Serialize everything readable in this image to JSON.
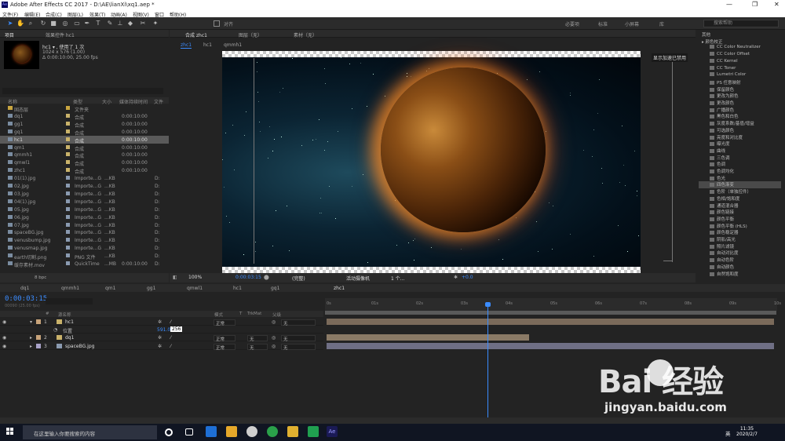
{
  "window": {
    "title": "Adobe After Effects CC 2017 - D:\\AE\\lianXi\\xq1.aep *",
    "logo": "Ae",
    "min": "—",
    "max": "❐",
    "close": "✕"
  },
  "menu": [
    "文件(F)",
    "编辑(E)",
    "合成(C)",
    "图层(L)",
    "效果(T)",
    "动画(A)",
    "视图(V)",
    "窗口",
    "帮助(H)"
  ],
  "toolbar": {
    "snap_label": "对齐",
    "workspaces": [
      "必要项",
      "标准",
      "小屏幕",
      "库"
    ],
    "search_placeholder": "搜索帮助"
  },
  "project": {
    "tabs": [
      "项目",
      "效果控件 hc1"
    ],
    "selected_name": "hc1 ▾ , 使用了 1 次",
    "selected_size": "1024 x 576 (1.00)",
    "selected_dur": "Δ 0:00:10:00, 25.00 fps",
    "columns": [
      "名称",
      "类型",
      "大小",
      "媒体持续时间",
      "文件"
    ],
    "rows": [
      {
        "name": "固态层",
        "type": "文件夹",
        "size": "",
        "dur": "",
        "fp": "",
        "kind": "folder",
        "swatch": "#c9a640"
      },
      {
        "name": "dq1",
        "type": "合成",
        "size": "",
        "dur": "0:00:10:00",
        "fp": "",
        "kind": "comp",
        "swatch": "#c9b26a"
      },
      {
        "name": "gg1",
        "type": "合成",
        "size": "",
        "dur": "0:00:10:00",
        "fp": "",
        "kind": "comp",
        "swatch": "#c9b26a"
      },
      {
        "name": "gq1",
        "type": "合成",
        "size": "",
        "dur": "0:00:10:00",
        "fp": "",
        "kind": "comp",
        "swatch": "#c9b26a"
      },
      {
        "name": "hc1",
        "type": "合成",
        "size": "",
        "dur": "0:00:10:00",
        "fp": "",
        "kind": "comp",
        "swatch": "#c9b26a",
        "selected": true
      },
      {
        "name": "qm1",
        "type": "合成",
        "size": "",
        "dur": "0:00:10:00",
        "fp": "",
        "kind": "comp",
        "swatch": "#c9b26a"
      },
      {
        "name": "qmmh1",
        "type": "合成",
        "size": "",
        "dur": "0:00:10:00",
        "fp": "",
        "kind": "comp",
        "swatch": "#c9b26a"
      },
      {
        "name": "qmwl1",
        "type": "合成",
        "size": "",
        "dur": "0:00:10:00",
        "fp": "",
        "kind": "comp",
        "swatch": "#c9b26a"
      },
      {
        "name": "zhc1",
        "type": "合成",
        "size": "",
        "dur": "0:00:10:00",
        "fp": "",
        "kind": "comp",
        "swatch": "#c9b26a"
      },
      {
        "name": "01(1).jpg",
        "type": "Importe...G",
        "size": "...KB",
        "dur": "",
        "fp": "D:",
        "kind": "file",
        "swatch": "#8a9ab0"
      },
      {
        "name": "02.jpg",
        "type": "Importe...G",
        "size": "...KB",
        "dur": "",
        "fp": "D:",
        "kind": "file",
        "swatch": "#8a9ab0"
      },
      {
        "name": "03.jpg",
        "type": "Importe...G",
        "size": "...KB",
        "dur": "",
        "fp": "D:",
        "kind": "file",
        "swatch": "#8a9ab0"
      },
      {
        "name": "04(1).jpg",
        "type": "Importe...G",
        "size": "...KB",
        "dur": "",
        "fp": "D:",
        "kind": "file",
        "swatch": "#8a9ab0"
      },
      {
        "name": "05.jpg",
        "type": "Importe...G",
        "size": "...KB",
        "dur": "",
        "fp": "D:",
        "kind": "file",
        "swatch": "#8a9ab0"
      },
      {
        "name": "06.jpg",
        "type": "Importe...G",
        "size": "...KB",
        "dur": "",
        "fp": "D:",
        "kind": "file",
        "swatch": "#8a9ab0"
      },
      {
        "name": "07.jpg",
        "type": "Importe...G",
        "size": "...KB",
        "dur": "",
        "fp": "D:",
        "kind": "file",
        "swatch": "#8a9ab0"
      },
      {
        "name": "spaceBG.jpg",
        "type": "Importe...G",
        "size": "...KB",
        "dur": "",
        "fp": "D:",
        "kind": "file",
        "swatch": "#8a9ab0"
      },
      {
        "name": "venusbump.jpg",
        "type": "Importe...G",
        "size": "...KB",
        "dur": "",
        "fp": "D:",
        "kind": "file",
        "swatch": "#8a9ab0"
      },
      {
        "name": "venusmap.jpg",
        "type": "Importe...G",
        "size": "...KB",
        "dur": "",
        "fp": "D:",
        "kind": "file",
        "swatch": "#8a9ab0"
      },
      {
        "name": "earth切割.png",
        "type": "PNG 文件",
        "size": "...KB",
        "dur": "",
        "fp": "D:",
        "kind": "file",
        "swatch": "#8a9ab0"
      },
      {
        "name": "缓存素材.mov",
        "type": "QuickTime",
        "size": "...MB",
        "dur": "0:00:10:00",
        "fp": "D:",
        "kind": "file",
        "swatch": "#8a9ab0"
      }
    ],
    "footer_bpc": "8 bpc"
  },
  "viewer": {
    "tabs": [
      "合成 zhc1",
      "图层（无）",
      "素材（无）"
    ],
    "breadcrumbs": [
      "zhc1",
      "hc1",
      "qmmh1"
    ],
    "badge": "显示加速已禁用",
    "zoom": "100%",
    "timecode": "0:00:03:15",
    "resolution": "(完整)",
    "camera": "活动摄像机",
    "views": "1 个...",
    "exposure": "+0.0"
  },
  "effects": {
    "items": [
      {
        "label": "其他",
        "indent": 0
      },
      {
        "label": "▸ 颜色校正",
        "indent": 0
      },
      {
        "label": "CC Color Neutralizer"
      },
      {
        "label": "CC Color Offset"
      },
      {
        "label": "CC Kernel"
      },
      {
        "label": "CC Toner"
      },
      {
        "label": "Lumetri Color"
      },
      {
        "label": "PS 任意映射"
      },
      {
        "label": "保留颜色"
      },
      {
        "label": "更改为颜色"
      },
      {
        "label": "更改颜色"
      },
      {
        "label": "广播颜色"
      },
      {
        "label": "黑色和白色"
      },
      {
        "label": "灰度系数/基值/增益"
      },
      {
        "label": "可选颜色"
      },
      {
        "label": "亮度和对比度"
      },
      {
        "label": "曝光度"
      },
      {
        "label": "曲线"
      },
      {
        "label": "三色调"
      },
      {
        "label": "色调"
      },
      {
        "label": "色调均化"
      },
      {
        "label": "色光"
      },
      {
        "label": "四色渐变",
        "selected": true
      },
      {
        "label": "色阶（单独控件）"
      },
      {
        "label": "色相/饱和度"
      },
      {
        "label": "通道混合器"
      },
      {
        "label": "颜色链接"
      },
      {
        "label": "颜色平衡"
      },
      {
        "label": "颜色平衡 (HLS)"
      },
      {
        "label": "颜色稳定器"
      },
      {
        "label": "阴影/高光"
      },
      {
        "label": "照片滤镜"
      },
      {
        "label": "自动对比度"
      },
      {
        "label": "自动色阶"
      },
      {
        "label": "自动颜色"
      },
      {
        "label": "自然饱和度"
      }
    ]
  },
  "timeline": {
    "tabs": [
      "dq1",
      "qmmh1",
      "qm1",
      "gg1",
      "qmwl1",
      "hc1",
      "gq1",
      "zhc1"
    ],
    "timecode": "0:00:03:15",
    "frames": "00090 (25.00 fps)",
    "headers": [
      "#",
      "源名称",
      "模式",
      "T",
      "TrkMat",
      "父级"
    ],
    "position_label": "位置",
    "position_x": "591.0",
    "position_y": "256",
    "layers": [
      {
        "num": "1",
        "name": "hc1",
        "mode": "正常",
        "trk": "",
        "parent": "无",
        "color": "#c7a37a"
      },
      {
        "num": "2",
        "name": "dq1",
        "mode": "正常",
        "trk": "无",
        "parent": "无",
        "color": "#c7a37a"
      },
      {
        "num": "3",
        "name": "spaceBG.jpg",
        "mode": "正常",
        "trk": "无",
        "parent": "无",
        "color": "#a9a3c9"
      }
    ],
    "ruler": [
      "0s",
      "01s",
      "02s",
      "03s",
      "04s",
      "05s",
      "06s",
      "07s",
      "08s",
      "09s",
      "10s"
    ],
    "bar_colors": {
      "hc1": "#7a6a5a",
      "dq1": "#8a7a66",
      "spaceBG": "#6f6f85"
    }
  },
  "taskbar": {
    "search_placeholder": "在这里输入你要搜索的内容",
    "time": "11:35",
    "date": "2020/2/7",
    "ime": "英"
  },
  "watermark": {
    "brand": "Bai  经验",
    "url": "jingyan.baidu.com"
  }
}
